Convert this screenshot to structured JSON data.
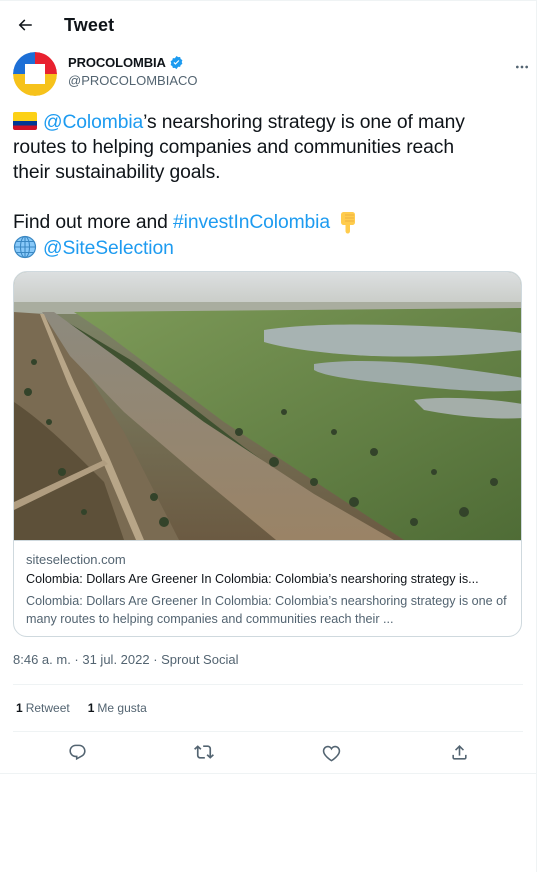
{
  "header": {
    "title": "Tweet"
  },
  "author": {
    "name": "PROCOLOMBIA",
    "handle": "@PROCOLOMBIACO"
  },
  "tweet": {
    "line1_mention": "@Colombia",
    "line1_rest": "’s nearshoring strategy is one of many",
    "line2": "routes to helping companies and communities reach",
    "line3": "their sustainability goals.",
    "line4_text": "Find out more and ",
    "line4_hashtag": "#investInColombia",
    "line5_mention": "@SiteSelection"
  },
  "card": {
    "domain": "siteselection.com",
    "title": "Colombia: Dollars Are Greener In Colombia: Colombia’s nearshoring strategy is...",
    "description": "Colombia: Dollars Are Greener In Colombia:  Colombia’s nearshoring strategy is one of many routes to helping companies and communities reach their ..."
  },
  "meta": {
    "timestamp": "8:46 a. m. · 31 jul. 2022 · Sprout Social"
  },
  "stats": {
    "retweets_count": "1",
    "retweets_label": "Retweet",
    "likes_count": "1",
    "likes_label": "Me gusta"
  },
  "colors": {
    "link": "#1d9bf0",
    "secondary": "#536471",
    "border": "#cfd9de"
  },
  "icons": [
    "back-arrow-icon",
    "verified-badge-icon",
    "more-icon",
    "colombia-flag-icon",
    "point-down-icon",
    "globe-icon",
    "reply-icon",
    "retweet-icon",
    "like-icon",
    "share-icon"
  ]
}
